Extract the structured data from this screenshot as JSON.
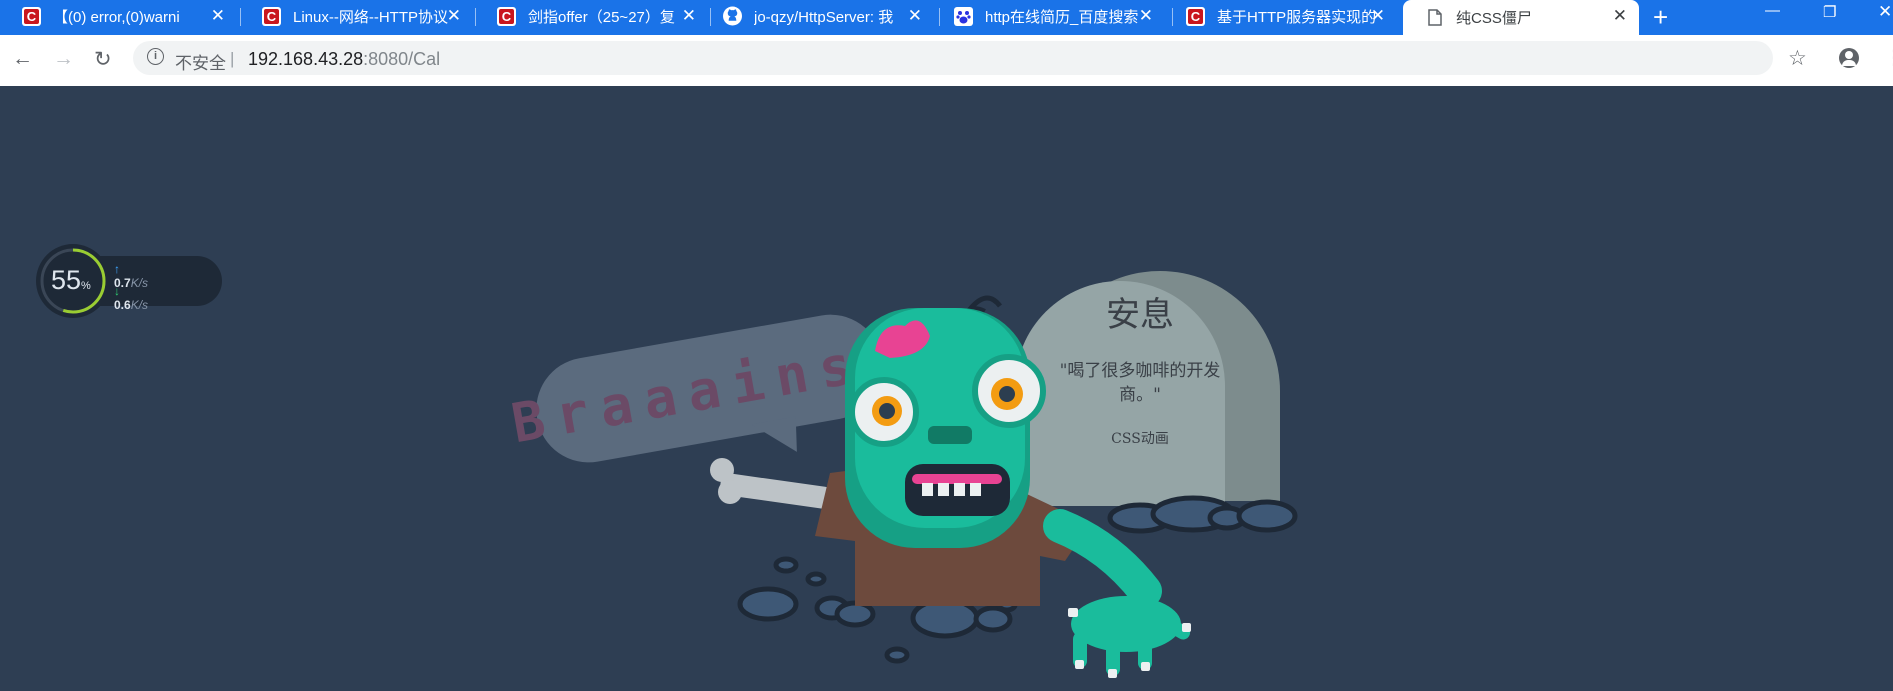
{
  "tabs": [
    {
      "title": "【(0) error,(0)warni",
      "icon": "csdn-icon"
    },
    {
      "title": "Linux--网络--HTTP协议",
      "icon": "csdn-icon"
    },
    {
      "title": "剑指offer（25~27）复",
      "icon": "csdn-icon"
    },
    {
      "title": "jo-qzy/HttpServer: 我",
      "icon": "github-icon"
    },
    {
      "title": "http在线简历_百度搜索",
      "icon": "baidu-icon"
    },
    {
      "title": "基于HTTP服务器实现的",
      "icon": "csdn-icon"
    },
    {
      "title": "纯CSS僵尸",
      "icon": "page-icon",
      "active": true
    }
  ],
  "address": {
    "security_label": "不安全",
    "separator": "|",
    "host": "192.168.43.28",
    "path": ":8080/Cal"
  },
  "netmon": {
    "percent": "55",
    "percent_unit": "%",
    "upload": "0.7",
    "download": "0.6",
    "unit": "K/s"
  },
  "scene": {
    "speech": "Braaains!",
    "tomb_title": "安息",
    "tomb_quote_1": "\"喝了很多咖啡的开发",
    "tomb_quote_2": "商。\"",
    "tomb_caption": "CSS动画"
  },
  "colors": {
    "tab_bar": "#1a73e8",
    "page_bg": "#2e3e53",
    "zombie_skin": "#1abc9c",
    "tombstone": "#95a5a6"
  }
}
